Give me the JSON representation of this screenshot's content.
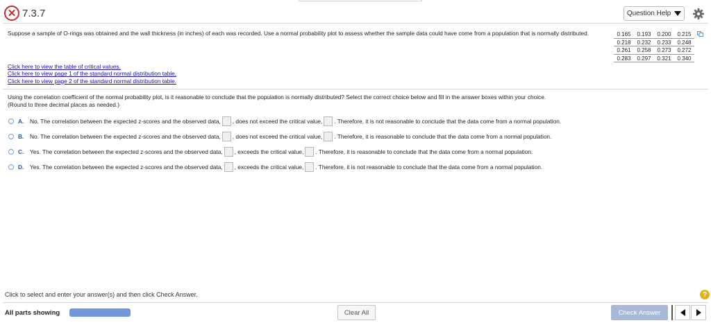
{
  "header": {
    "question_number": "7.3.7",
    "question_help_label": "Question Help",
    "status_icon": "incorrect-x-icon",
    "settings_icon": "gear-icon"
  },
  "prompt": {
    "text": "Suppose a sample of O-rings was obtained and the wall thickness (in inches) of each was recorded. Use a normal probability plot to assess whether the sample data could have come from a population that is normally distributed."
  },
  "data_table": {
    "rows": [
      [
        "0.165",
        "0.193",
        "0.200",
        "0.215"
      ],
      [
        "0.218",
        "0.232",
        "0.233",
        "0.248"
      ],
      [
        "0.261",
        "0.258",
        "0.273",
        "0.272"
      ],
      [
        "0.283",
        "0.297",
        "0.321",
        "0.340"
      ]
    ]
  },
  "links": [
    "Click here to view the table of critical values.",
    "Click here to view page 1 of the standard normal distribution table.",
    "Click here to view page 2 of the standard normal distribution table."
  ],
  "question": {
    "text": "Using the correlation coefficient of the normal probability plot, is it reasonable to conclude that the population is normally distributed? Select the correct choice below and fill in the answer boxes within your choice.",
    "instruction": "(Round to three decimal places as needed.)"
  },
  "choices": [
    {
      "letter": "A.",
      "part1": "No. The correlation between the expected z-scores and the observed data,",
      "part2": ", does not exceed the critical value,",
      "part3": ". Therefore, it is not reasonable to conclude that the data come from a normal population."
    },
    {
      "letter": "B.",
      "part1": "No. The correlation between the expected z-scores and the observed data,",
      "part2": ", does not exceed the critical value,",
      "part3": ". Therefore, it is reasonable to conclude that the data come from a normal population."
    },
    {
      "letter": "C.",
      "part1": "Yes. The correlation between the expected z-scores and the observed data,",
      "part2": ", exceeds the critical value,",
      "part3": ". Therefore, it is reasonable to conclude that the data come from a normal population."
    },
    {
      "letter": "D.",
      "part1": "Yes. The correlation between the expected z-scores and the observed data,",
      "part2": ", exceeds the critical value,",
      "part3": ". Therefore, it is not reasonable to conclude that the data come from a normal population."
    }
  ],
  "footer": {
    "instruction": "Click to select and enter your answer(s) and then click Check Answer.",
    "parts_label": "All parts showing",
    "progress_fraction": 1.0,
    "clear_all_label": "Clear All",
    "check_answer_label": "Check Answer",
    "help_icon_label": "?"
  },
  "colors": {
    "incorrect_red": "#c8282e",
    "link_blue": "#1a0dab",
    "choice_letter_blue": "#1f59a8",
    "progress_blue": "#6f97d9",
    "check_answer_bg": "#a7b9d6",
    "help_gold": "#e0b325"
  }
}
